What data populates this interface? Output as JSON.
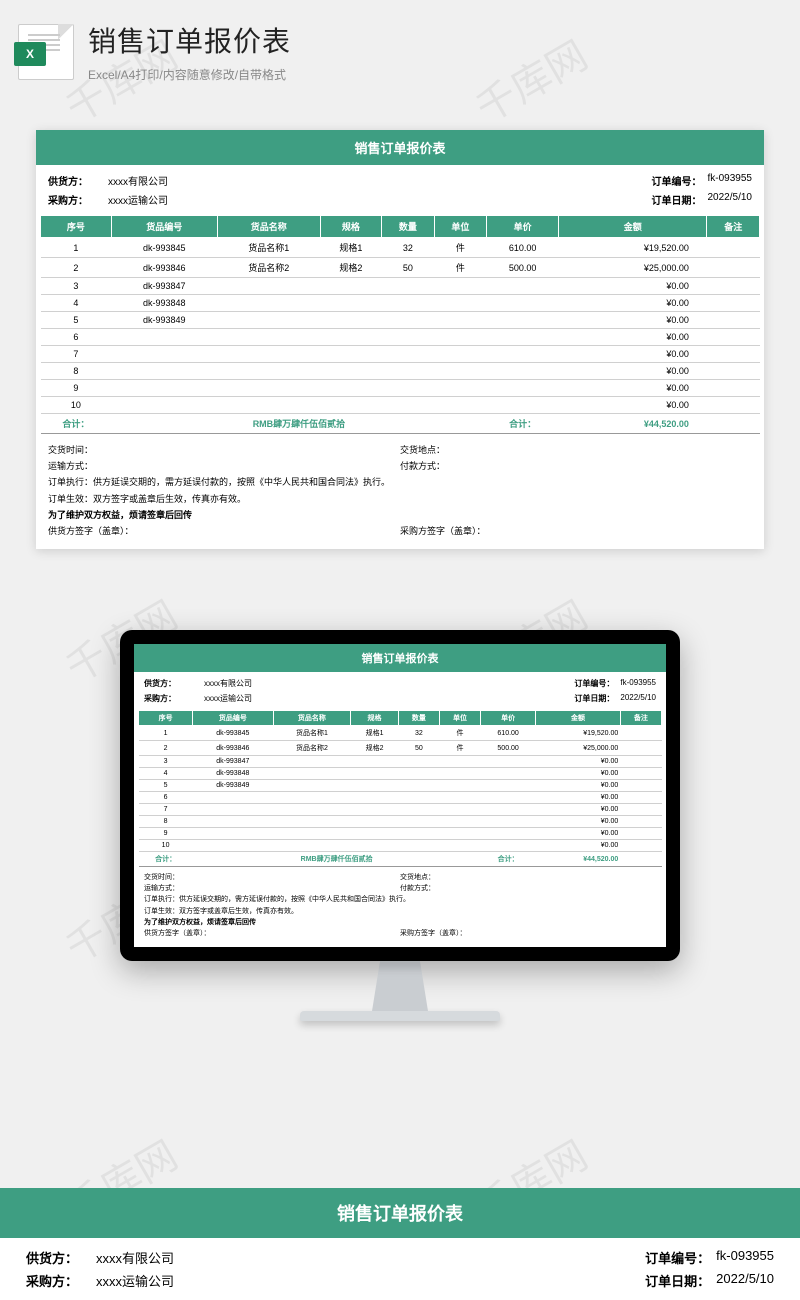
{
  "page": {
    "title": "销售订单报价表",
    "subtitle": "Excel/A4打印/内容随意修改/自带格式",
    "icon_badge": "X"
  },
  "sheet": {
    "title": "销售订单报价表",
    "supplier_label": "供货方：",
    "supplier_value": "xxxx有限公司",
    "buyer_label": "采购方：",
    "buyer_value": "xxxx运输公司",
    "order_no_label": "订单编号：",
    "order_no_value": "fk-093955",
    "order_date_label": "订单日期：",
    "order_date_value": "2022/5/10",
    "headers": [
      "序号",
      "货品编号",
      "货品名称",
      "规格",
      "数量",
      "单位",
      "单价",
      "金额",
      "备注"
    ],
    "rows": [
      {
        "n": "1",
        "code": "dk-993845",
        "name": "货品名称1",
        "spec": "规格1",
        "qty": "32",
        "unit": "件",
        "price": "610.00",
        "amt": "¥19,520.00",
        "note": ""
      },
      {
        "n": "2",
        "code": "dk-993846",
        "name": "货品名称2",
        "spec": "规格2",
        "qty": "50",
        "unit": "件",
        "price": "500.00",
        "amt": "¥25,000.00",
        "note": ""
      },
      {
        "n": "3",
        "code": "dk-993847",
        "name": "",
        "spec": "",
        "qty": "",
        "unit": "",
        "price": "",
        "amt": "¥0.00",
        "note": ""
      },
      {
        "n": "4",
        "code": "dk-993848",
        "name": "",
        "spec": "",
        "qty": "",
        "unit": "",
        "price": "",
        "amt": "¥0.00",
        "note": ""
      },
      {
        "n": "5",
        "code": "dk-993849",
        "name": "",
        "spec": "",
        "qty": "",
        "unit": "",
        "price": "",
        "amt": "¥0.00",
        "note": ""
      },
      {
        "n": "6",
        "code": "",
        "name": "",
        "spec": "",
        "qty": "",
        "unit": "",
        "price": "",
        "amt": "¥0.00",
        "note": ""
      },
      {
        "n": "7",
        "code": "",
        "name": "",
        "spec": "",
        "qty": "",
        "unit": "",
        "price": "",
        "amt": "¥0.00",
        "note": ""
      },
      {
        "n": "8",
        "code": "",
        "name": "",
        "spec": "",
        "qty": "",
        "unit": "",
        "price": "",
        "amt": "¥0.00",
        "note": ""
      },
      {
        "n": "9",
        "code": "",
        "name": "",
        "spec": "",
        "qty": "",
        "unit": "",
        "price": "",
        "amt": "¥0.00",
        "note": ""
      },
      {
        "n": "10",
        "code": "",
        "name": "",
        "spec": "",
        "qty": "",
        "unit": "",
        "price": "",
        "amt": "¥0.00",
        "note": ""
      }
    ],
    "total_label": "合计：",
    "total_words": "RMB肆万肆仟伍佰贰拾",
    "total_label2": "合计：",
    "total_amount": "¥44,520.00",
    "terms": {
      "t1a": "交货时间：",
      "t1b": "交货地点：",
      "t2a": "运输方式：",
      "t2b": "付款方式：",
      "t3": "订单执行：供方延误交期的，需方延误付款的，按照《中华人民共和国合同法》执行。",
      "t4": "订单生效：双方签字或盖章后生效，传真亦有效。",
      "t5": "为了维护双方权益，烦请签章后回传",
      "t6a": "供货方签字（盖章）：",
      "t6b": "采购方签字（盖章）："
    }
  },
  "watermark": "千库网"
}
